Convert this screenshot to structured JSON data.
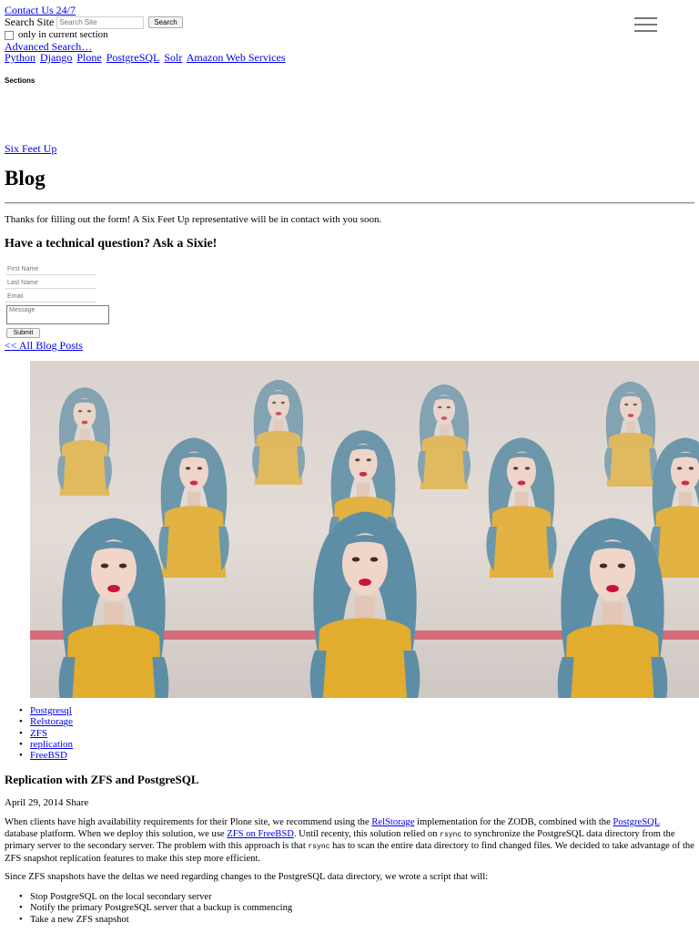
{
  "header": {
    "contact_link": "Contact Us 24/7",
    "search_label": "Search Site",
    "search_placeholder": "Search Site",
    "search_button": "Search",
    "section_checkbox_label": "only in current section",
    "advanced_search": "Advanced Search…",
    "nav_links": [
      "Python",
      "Django",
      "Plone",
      "PostgreSQL",
      "Solr",
      "Amazon Web Services"
    ],
    "menu_icon": "hamburger-menu-icon",
    "sections_label": "Sections"
  },
  "brand_link": "Six Feet Up",
  "page_title": "Blog",
  "form": {
    "thanks_message": "Thanks for filling out the form! A Six Feet Up representative will be in contact with you soon.",
    "heading": "Have a technical question? Ask a Sixie!",
    "first_name_placeholder": "First Name",
    "last_name_placeholder": "Last Name",
    "email_placeholder": "Email",
    "message_placeholder": "Message",
    "submit_label": "Submit"
  },
  "all_posts_link": "<< All Blog Posts",
  "hero_image": "repeated-portraits-blue-hair-women-photo",
  "tags": [
    "Postgresql",
    "Relstorage",
    "ZFS",
    "replication",
    "FreeBSD"
  ],
  "post": {
    "title": "Replication with ZFS and PostgreSQL",
    "date": "April 29, 2014",
    "share_label": "Share",
    "para1_a": "When clients have high availability requirements for their Plone site, we recommend using the ",
    "link_relstorage": "RelStorage",
    "para1_b": " implementation for the ZODB, combined with the ",
    "link_postgresql": "PostgreSQL",
    "para1_c": " database platform. When we deploy this solution, we use ",
    "link_zfs": "ZFS on FreeBSD",
    "para1_d": ". Until recenty, this solution relied on ",
    "code_rsync": "rsync",
    "para1_e": " to synchronize the PostgreSQL data directory from the primary server to the secondary server. The problem with this approach is that ",
    "para1_f": " has to scan the entire data directory to find changed files. We decided to take advantage of the ZFS snapshot replication features to make this step more efficient.",
    "para2": "Since ZFS snapshots have the deltas we need regarding changes to the PostgreSQL data directory, we wrote a script that will:",
    "steps": [
      "Stop PostgreSQL on the local secondary server",
      "Notify the primary PostgreSQL server that a backup is commencing",
      "Take a new ZFS snapshot"
    ]
  },
  "colors": {
    "link": "#0000ee",
    "hair": "#5f8fa8",
    "dress": "#e2ad2e",
    "lips": "#c8143c"
  }
}
